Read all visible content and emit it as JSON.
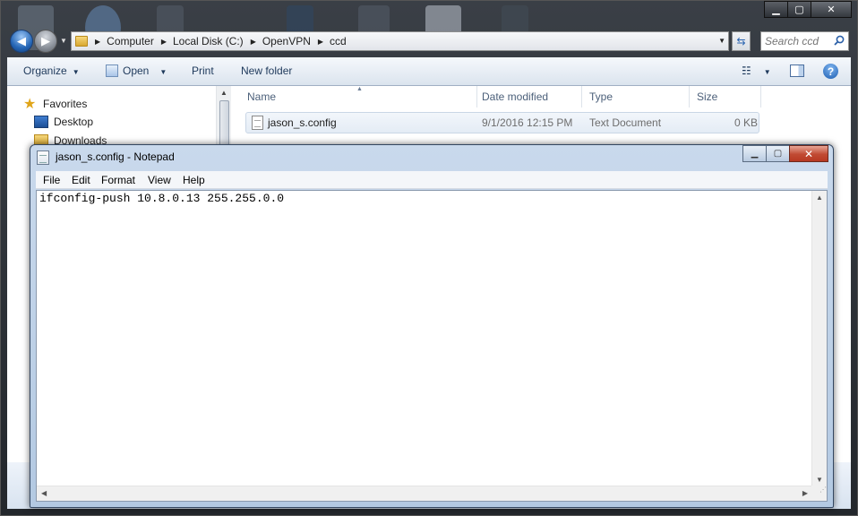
{
  "explorer": {
    "caption": {
      "minimize": "▁",
      "maximize": "▢",
      "close": "✕"
    },
    "address": {
      "crumbs": [
        "Computer",
        "Local Disk (C:)",
        "OpenVPN",
        "ccd"
      ]
    },
    "search": {
      "placeholder": "Search ccd"
    },
    "toolbar": {
      "organize": "Organize",
      "open": "Open",
      "print": "Print",
      "new_folder": "New folder"
    },
    "nav_pane": {
      "favorites": "Favorites",
      "desktop": "Desktop",
      "downloads": "Downloads"
    },
    "columns": {
      "name": "Name",
      "date_modified": "Date modified",
      "type": "Type",
      "size": "Size"
    },
    "files": [
      {
        "name": "jason_s.config",
        "date_modified": "9/1/2016 12:15 PM",
        "type": "Text Document",
        "size": "0 KB"
      }
    ]
  },
  "notepad": {
    "title": "jason_s.config - Notepad",
    "menu": [
      "File",
      "Edit",
      "Format",
      "View",
      "Help"
    ],
    "content": "ifconfig-push 10.8.0.13 255.255.0.0"
  },
  "colors": {
    "titlebar_dark": "#23272c",
    "notepad_frame": "#c9d9ec",
    "close_red": "#c04a33",
    "selected_row": "#e4ecf5"
  }
}
